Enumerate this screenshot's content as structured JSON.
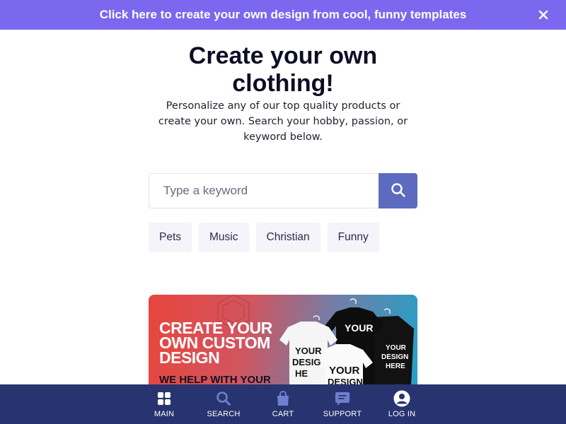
{
  "promo": {
    "text": "Click here to create your own design from cool, funny templates",
    "close_icon": "close-icon"
  },
  "hero": {
    "title": "Create your own clothing!",
    "subtitle": "Personalize any of our top quality products or create your own. Search your hobby, passion, or keyword below."
  },
  "search": {
    "placeholder": "Type a keyword",
    "value": "",
    "button_icon": "search-icon"
  },
  "chips": [
    {
      "label": "Pets"
    },
    {
      "label": "Music"
    },
    {
      "label": "Christian"
    },
    {
      "label": "Funny"
    }
  ],
  "banner": {
    "headline": "CREATE YOUR OWN CUSTOM DESIGN",
    "subline": "WE HELP WITH YOUR",
    "shirt_text": "YOUR DESIGN HERE"
  },
  "bottom_nav": {
    "items": [
      {
        "label": "MAIN",
        "icon": "grid-icon"
      },
      {
        "label": "SEARCH",
        "icon": "search-icon"
      },
      {
        "label": "CART",
        "icon": "shopping-bag-icon"
      },
      {
        "label": "SUPPORT",
        "icon": "chat-icon"
      },
      {
        "label": "LOG IN",
        "icon": "user-icon"
      }
    ]
  },
  "colors": {
    "promo_bg": "#7b68ee",
    "search_button": "#5c6bc0",
    "chip_bg": "#f4f4fa",
    "nav_bg": "#283470"
  }
}
